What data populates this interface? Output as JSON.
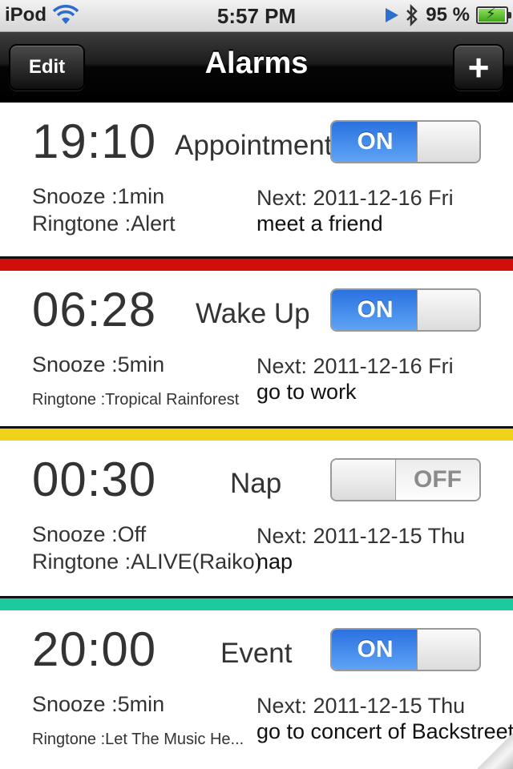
{
  "status_bar": {
    "carrier": "iPod",
    "time": "5:57 PM",
    "battery": "95 %",
    "icons": [
      "wifi-icon",
      "location-icon",
      "bluetooth-icon",
      "battery-icon"
    ]
  },
  "nav": {
    "title": "Alarms",
    "edit_label": "Edit",
    "add_label": "+"
  },
  "alarms": [
    {
      "time": "19:10",
      "name": "Appointment",
      "toggle": "ON",
      "snooze": "Snooze :1min",
      "ringtone": "Ringtone :Alert",
      "next": "Next: 2011-12-16 Fri",
      "memo": "meet a friend",
      "divider_color": "#d10f0a"
    },
    {
      "time": "06:28",
      "name": "Wake Up",
      "toggle": "ON",
      "snooze": "Snooze :5min",
      "ringtone": "Ringtone :Tropical Rainforest",
      "next": "Next: 2011-12-16 Fri",
      "memo": "go to work",
      "divider_color": "#f1d21a"
    },
    {
      "time": "00:30",
      "name": "Nap",
      "toggle": "OFF",
      "snooze": "Snooze :Off",
      "ringtone": "Ringtone :ALIVE(Raiko)",
      "next": "Next: 2011-12-15 Thu",
      "memo": "nap",
      "divider_color": "#1ec9a0"
    },
    {
      "time": "20:00",
      "name": "Event",
      "toggle": "ON",
      "snooze": "Snooze :5min",
      "ringtone": "Ringtone :Let The Music He...",
      "next": "Next: 2011-12-15 Thu",
      "memo": "go to concert of Backstreet"
    }
  ]
}
